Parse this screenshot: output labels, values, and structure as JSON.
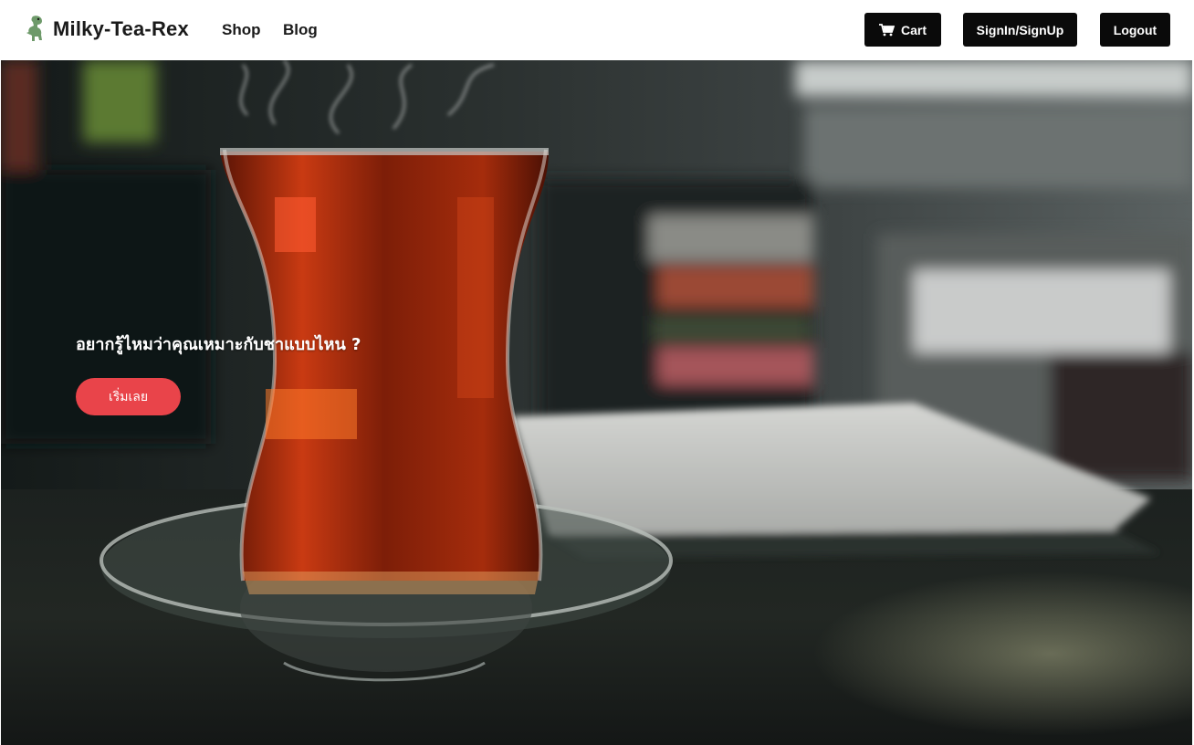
{
  "navbar": {
    "brand": "Milky-Tea-Rex",
    "links": {
      "shop": "Shop",
      "blog": "Blog"
    },
    "buttons": {
      "cart": "Cart",
      "signin": "SignIn/SignUp",
      "logout": "Logout"
    },
    "icons": {
      "logo": "dinosaur-logo-icon",
      "cart": "cart-icon"
    }
  },
  "hero": {
    "headline": "อยากรู้ไหมว่าคุณเหมาะกับชาแบบไหน ?",
    "cta_label": "เริ่มเลย",
    "background": "photo of steaming tea in glass on saucer, wooden table, blurred desk",
    "colors": {
      "cta": "#e9444a",
      "tea": "#b5300e",
      "button_dark": "#0a0a0a"
    }
  }
}
